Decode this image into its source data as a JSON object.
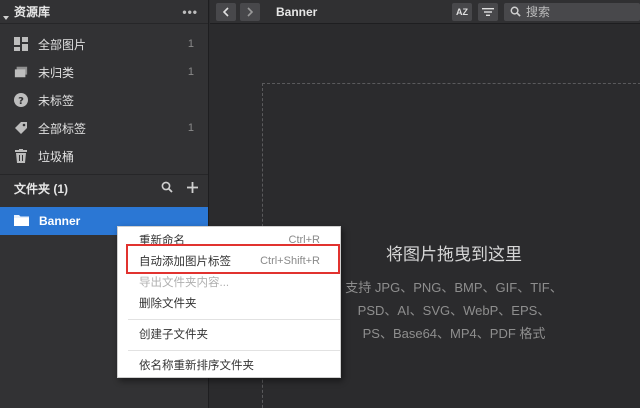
{
  "sidebar": {
    "header": {
      "title": "资源库",
      "more": "•••"
    },
    "items": [
      {
        "label": "全部图片",
        "count": "1",
        "icon": "grid-icon"
      },
      {
        "label": "未归类",
        "count": "1",
        "icon": "unsorted-icon"
      },
      {
        "label": "未标签",
        "count": "",
        "icon": "question-icon"
      },
      {
        "label": "全部标签",
        "count": "1",
        "icon": "tag-icon"
      },
      {
        "label": "垃圾桶",
        "count": "",
        "icon": "trash-icon"
      }
    ],
    "folders": {
      "title": "文件夹 (1)",
      "items": [
        {
          "label": "Banner",
          "icon": "folder-icon"
        }
      ]
    }
  },
  "toolbar": {
    "title": "Banner",
    "sort_label": "AZ",
    "search_placeholder": "搜索"
  },
  "dropzone": {
    "title": "将图片拖曳到这里",
    "lines": [
      "支持 JPG、PNG、BMP、GIF、TIF、",
      "PSD、AI、SVG、WebP、EPS、",
      "PS、Base64、MP4、PDF 格式"
    ]
  },
  "context_menu": {
    "items": [
      {
        "label": "重新命名",
        "shortcut": "Ctrl+R",
        "disabled": false
      },
      {
        "label": "自动添加图片标签",
        "shortcut": "Ctrl+Shift+R",
        "disabled": false
      },
      {
        "label": "导出文件夹内容...",
        "shortcut": "",
        "disabled": true
      },
      {
        "label": "删除文件夹",
        "shortcut": "",
        "disabled": false
      },
      {
        "label": "创建子文件夹",
        "shortcut": "",
        "disabled": false
      },
      {
        "label": "依名称重新排序文件夹",
        "shortcut": "",
        "disabled": false
      }
    ]
  },
  "colors": {
    "accent": "#2b77d4",
    "highlight": "#e1322f",
    "background": "#2b2b2d",
    "sidebar": "#323234"
  }
}
